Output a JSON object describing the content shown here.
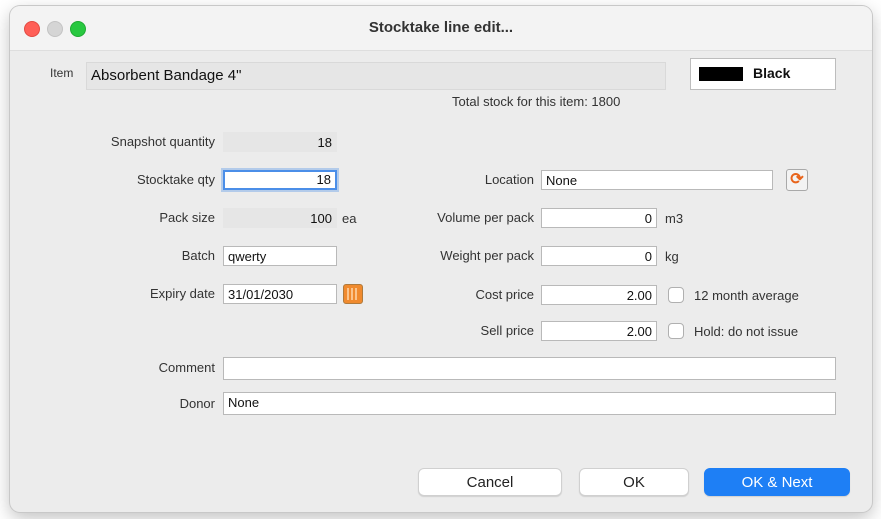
{
  "window": {
    "title": "Stocktake line edit..."
  },
  "item": {
    "label": "Item",
    "value": "Absorbent Bandage 4\""
  },
  "color": {
    "label": "Black",
    "swatch_color": "#000000"
  },
  "total_stock": "Total stock for this item: 1800",
  "fields": {
    "snapshot_qty": {
      "label": "Snapshot quantity",
      "value": "18"
    },
    "stocktake_qty": {
      "label": "Stocktake qty",
      "value": "18"
    },
    "pack_size": {
      "label": "Pack size",
      "value": "100",
      "unit": "ea"
    },
    "batch": {
      "label": "Batch",
      "value": "qwerty"
    },
    "expiry_date": {
      "label": "Expiry date",
      "value": "31/01/2030"
    },
    "location": {
      "label": "Location",
      "value": "None"
    },
    "volume_per_pack": {
      "label": "Volume per pack",
      "value": "0",
      "unit": "m3"
    },
    "weight_per_pack": {
      "label": "Weight per pack",
      "value": "0",
      "unit": "kg"
    },
    "cost_price": {
      "label": "Cost price",
      "value": "2.00"
    },
    "sell_price": {
      "label": "Sell price",
      "value": "2.00"
    },
    "comment": {
      "label": "Comment",
      "value": ""
    },
    "donor": {
      "label": "Donor",
      "value": "None"
    }
  },
  "checkboxes": {
    "twelve_month_average": {
      "label": "12 month average",
      "checked": false
    },
    "hold": {
      "label": "Hold: do not issue",
      "checked": false
    }
  },
  "buttons": {
    "cancel": "Cancel",
    "ok": "OK",
    "ok_next": "OK & Next"
  },
  "colors": {
    "accent": "#1e7ff5",
    "focus_ring": "#4b8ee8"
  }
}
